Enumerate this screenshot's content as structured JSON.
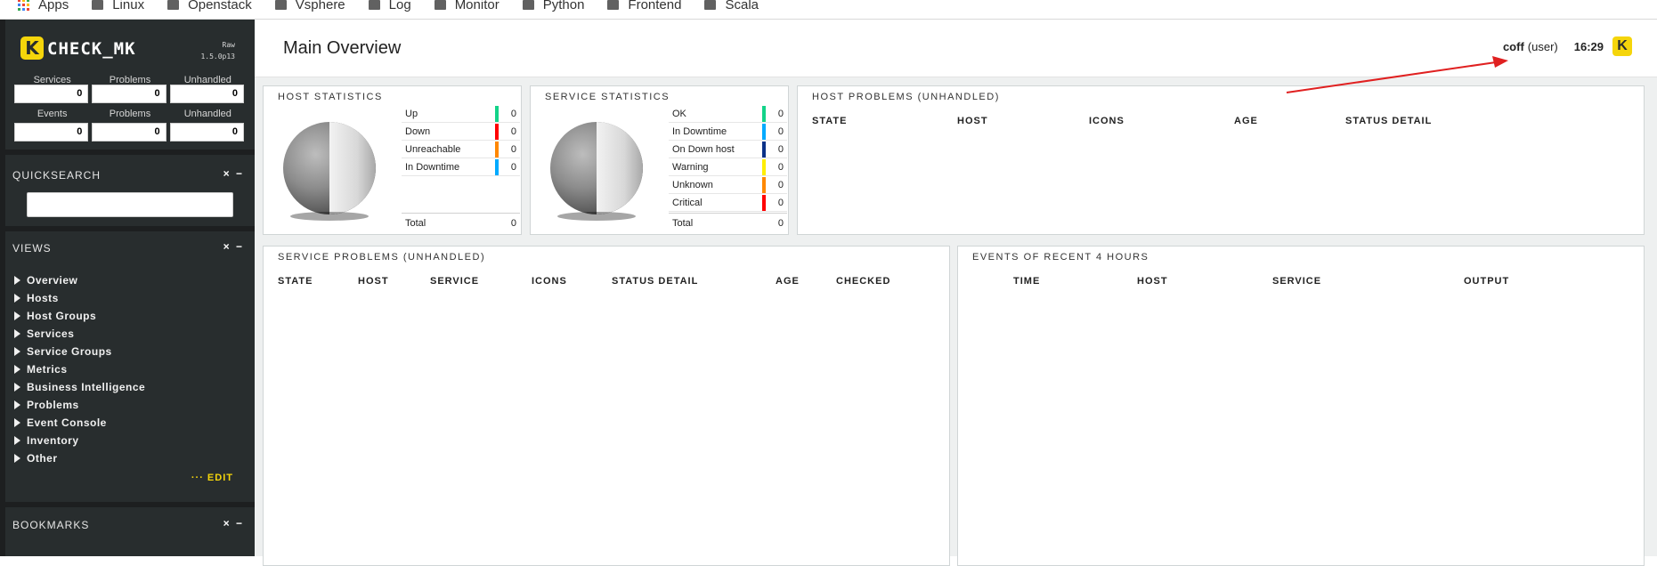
{
  "bookmarks": [
    {
      "label": "Apps",
      "type": "apps"
    },
    {
      "label": "Linux",
      "type": "folder"
    },
    {
      "label": "Openstack",
      "type": "folder"
    },
    {
      "label": "Vsphere",
      "type": "folder"
    },
    {
      "label": "Log",
      "type": "folder"
    },
    {
      "label": "Monitor",
      "type": "folder"
    },
    {
      "label": "Python",
      "type": "folder"
    },
    {
      "label": "Frontend",
      "type": "folder"
    },
    {
      "label": "Scala",
      "type": "folder"
    }
  ],
  "sidebar": {
    "logo_text": "CHECK_MK",
    "logo_letter": "K",
    "version_line1": "Raw",
    "version_line2": "1.5.0p13",
    "tactical": {
      "row1_headers": [
        "Services",
        "Problems",
        "Unhandled"
      ],
      "row1_values": [
        "0",
        "0",
        "0"
      ],
      "row2_headers": [
        "Events",
        "Problems",
        "Unhandled"
      ],
      "row2_values": [
        "0",
        "0",
        "0"
      ]
    },
    "quicksearch_title": "QUICKSEARCH",
    "views_title": "VIEWS",
    "views": [
      "Overview",
      "Hosts",
      "Host Groups",
      "Services",
      "Service Groups",
      "Metrics",
      "Business Intelligence",
      "Problems",
      "Event Console",
      "Inventory",
      "Other"
    ],
    "edit_label": "··· EDIT",
    "bookmarks_title": "BOOKMARKS",
    "snapin_controls": "× −"
  },
  "header": {
    "title": "Main Overview",
    "user": "coff",
    "role": "(user)",
    "time": "16:29"
  },
  "host_stats": {
    "title": "HOST STATISTICS",
    "rows": [
      {
        "label": "Up",
        "value": "0",
        "color": "#13d389"
      },
      {
        "label": "Down",
        "value": "0",
        "color": "#ff0000"
      },
      {
        "label": "Unreachable",
        "value": "0",
        "color": "#ff8800"
      },
      {
        "label": "In Downtime",
        "value": "0",
        "color": "#00aaff"
      }
    ],
    "total_label": "Total",
    "total_value": "0"
  },
  "service_stats": {
    "title": "SERVICE STATISTICS",
    "rows": [
      {
        "label": "OK",
        "value": "0",
        "color": "#13d389"
      },
      {
        "label": "In Downtime",
        "value": "0",
        "color": "#00aaff"
      },
      {
        "label": "On Down host",
        "value": "0",
        "color": "#0b3288"
      },
      {
        "label": "Warning",
        "value": "0",
        "color": "#ffee00"
      },
      {
        "label": "Unknown",
        "value": "0",
        "color": "#ff8800"
      },
      {
        "label": "Critical",
        "value": "0",
        "color": "#ff0000"
      }
    ],
    "total_label": "Total",
    "total_value": "0"
  },
  "host_problems": {
    "title": "HOST PROBLEMS (UNHANDLED)",
    "columns": [
      "STATE",
      "HOST",
      "ICONS",
      "AGE",
      "STATUS DETAIL"
    ]
  },
  "service_problems": {
    "title": "SERVICE PROBLEMS (UNHANDLED)",
    "columns": [
      "STATE",
      "HOST",
      "SERVICE",
      "ICONS",
      "STATUS DETAIL",
      "AGE",
      "CHECKED"
    ]
  },
  "events": {
    "title": "EVENTS OF RECENT 4 HOURS",
    "columns": [
      "TIME",
      "HOST",
      "SERVICE",
      "OUTPUT"
    ]
  },
  "colors": {
    "accent": "#f5d50b",
    "sidebar_bg": "#282d2e",
    "annotation_arrow": "#e02020"
  }
}
